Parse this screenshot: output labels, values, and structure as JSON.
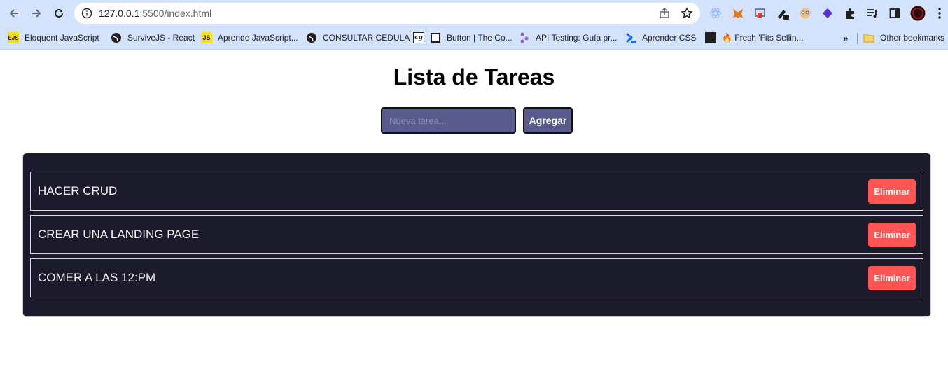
{
  "browser": {
    "url_host": "127.0.0.1",
    "url_rest": ":5500/index.html"
  },
  "bookmarks": [
    {
      "label": "Eloquent JavaScript",
      "favicon": "EJS"
    },
    {
      "label": "SurviveJS - React",
      "favicon": "globe-icon"
    },
    {
      "label": "Aprende JavaScript...",
      "favicon": "JS"
    },
    {
      "label": "CONSULTAR CEDULA",
      "favicon": "globe-icon"
    },
    {
      "label": "",
      "favicon": "cg"
    },
    {
      "label": "Button | The Co...",
      "favicon": "square-icon"
    },
    {
      "label": "API Testing: Guía pr...",
      "favicon": "api-icon"
    },
    {
      "label": "Aprender CSS",
      "favicon": "chevron-icon"
    },
    {
      "label": "",
      "favicon": "dark-icon"
    },
    {
      "label": "🔥 Fresh 'Fits Sellin...",
      "favicon": ""
    }
  ],
  "bookmarks_more": "»",
  "other_bookmarks": "Other bookmarks",
  "page": {
    "title": "Lista de Tareas",
    "input_placeholder": "Nueva tarea...",
    "add_label": "Agregar",
    "tasks": [
      {
        "text": "HACER CRUD",
        "delete_label": "Eliminar"
      },
      {
        "text": "CREAR UNA LANDING PAGE",
        "delete_label": "Eliminar"
      },
      {
        "text": "COMER A LAS 12:PM",
        "delete_label": "Eliminar"
      }
    ]
  },
  "colors": {
    "accent": "#585b8c",
    "panel": "#1c1b2c",
    "delete": "#ff5555"
  }
}
